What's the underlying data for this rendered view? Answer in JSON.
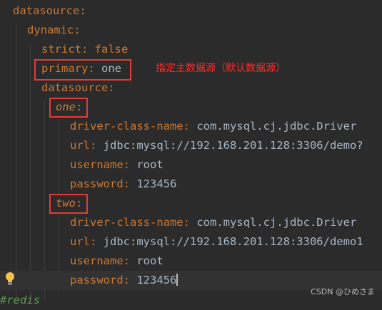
{
  "lines": {
    "l1": {
      "key": "datasource"
    },
    "l2": {
      "key": "dynamic"
    },
    "l3": {
      "key": "strict",
      "value": "false"
    },
    "l4": {
      "key": "primary",
      "value": "one"
    },
    "l5": {
      "key": "datasource"
    },
    "l6": {
      "key": "one"
    },
    "l7": {
      "key": "driver-class-name",
      "value": "com.mysql.cj.jdbc.Driver"
    },
    "l8": {
      "key": "url",
      "value": "jdbc:mysql://192.168.201.128:3306/demo?"
    },
    "l9": {
      "key": "username",
      "value": "root"
    },
    "l10": {
      "key": "password",
      "value": "123456"
    },
    "l11": {
      "key": "two"
    },
    "l12": {
      "key": "driver-class-name",
      "value": "com.mysql.cj.jdbc.Driver"
    },
    "l13": {
      "key": "url",
      "value": "jdbc:mysql://192.168.201.128:3306/demo1"
    },
    "l14": {
      "key": "username",
      "value": "root"
    },
    "l15": {
      "key": "password",
      "value": "123456"
    },
    "l16": {
      "comment": "#redis"
    }
  },
  "annotation": "指定主数据源（默认数据源）",
  "watermark": "CSDN @ひめさま",
  "icons": {
    "bulb": "lightbulb-icon"
  },
  "colors": {
    "background": "#2b2b2b",
    "key": "#cc7832",
    "value": "#a9b7c6",
    "highlight_box": "#e53935",
    "annotation": "#ff2b2b"
  }
}
